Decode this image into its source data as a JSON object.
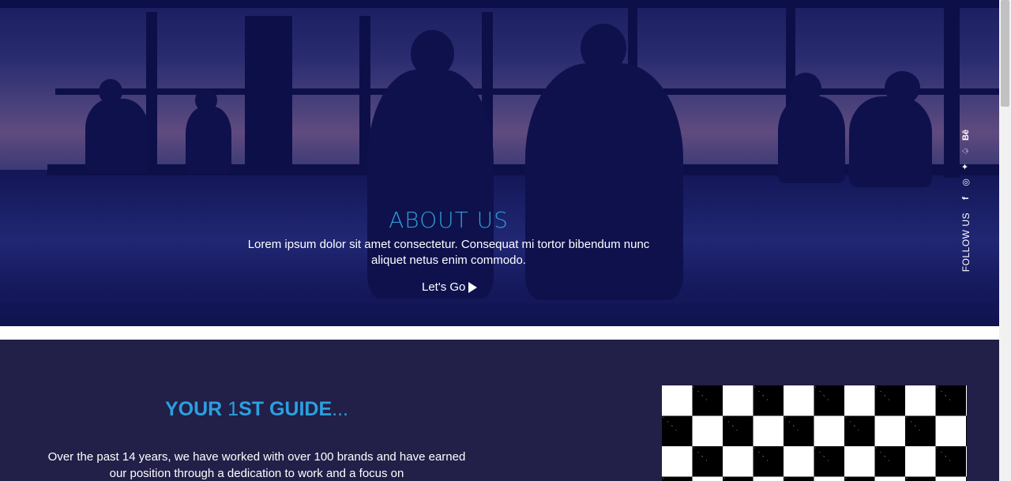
{
  "hero": {
    "title": "ABOUT US",
    "text": "Lorem ipsum dolor sit amet consectetur. Consequat mi tortor bibendum nunc aliquet netus enim commodo.",
    "cta_label": "Let's Go",
    "cta_icon": "play-icon"
  },
  "social": {
    "label": "FOLLOW US",
    "icons": [
      {
        "name": "facebook-icon",
        "glyph": "f"
      },
      {
        "name": "instagram-icon",
        "glyph": "◎"
      },
      {
        "name": "twitter-icon",
        "glyph": "✦"
      },
      {
        "name": "snapchat-icon",
        "glyph": "♤"
      },
      {
        "name": "behance-icon",
        "glyph": "Bē"
      }
    ]
  },
  "guide": {
    "title_part1": "YOUR ",
    "title_part2": "1",
    "title_part3": "ST GUIDE",
    "title_part4": "...",
    "text": "Over the past 14 years, we have worked with over 100 brands and have earned our position through a dedication to work and a focus on"
  },
  "colors": {
    "accent": "#2ba0e0",
    "section_bg": "#221f48",
    "hero_tint": "#1a1c5c"
  }
}
